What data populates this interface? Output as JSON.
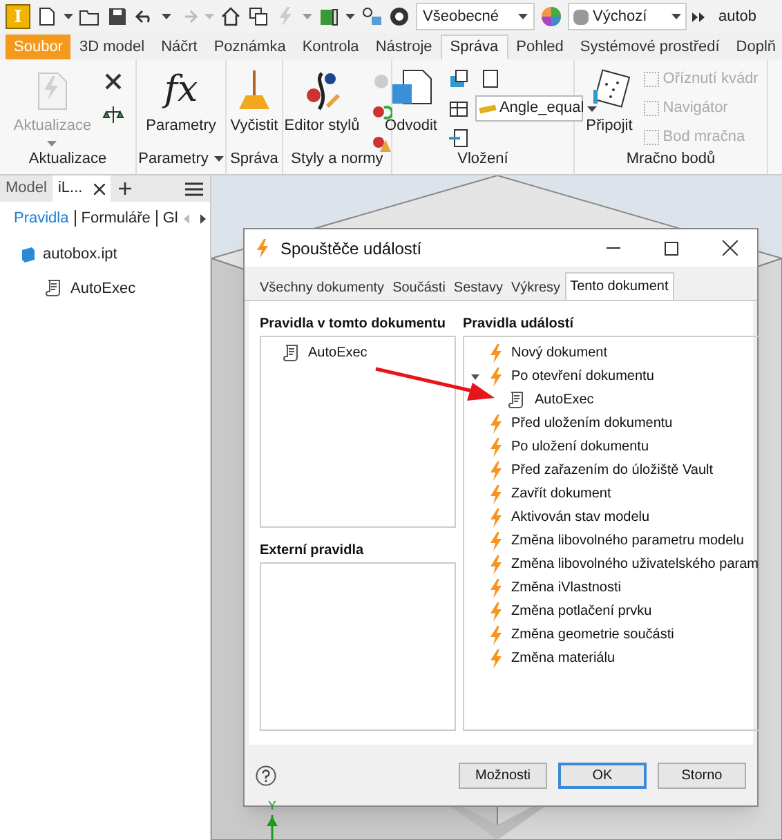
{
  "app_logo": "I",
  "quick_access": {
    "style_dropdown": "Všeobecné",
    "appearance_dropdown": "Výchozí",
    "window_title": "autob"
  },
  "ribbon_tabs": [
    {
      "label": "Soubor",
      "kind": "file",
      "selected": false
    },
    {
      "label": "3D model",
      "kind": "tab",
      "selected": false
    },
    {
      "label": "Náčrt",
      "kind": "tab",
      "selected": false
    },
    {
      "label": "Poznámka",
      "kind": "tab",
      "selected": false
    },
    {
      "label": "Kontrola",
      "kind": "tab",
      "selected": false
    },
    {
      "label": "Nástroje",
      "kind": "tab",
      "selected": false
    },
    {
      "label": "Správa",
      "kind": "tab",
      "selected": true
    },
    {
      "label": "Pohled",
      "kind": "tab",
      "selected": false
    },
    {
      "label": "Systémové prostředí",
      "kind": "tab",
      "selected": false
    },
    {
      "label": "Doplň",
      "kind": "tab",
      "selected": false
    }
  ],
  "ribbon_panels": [
    {
      "title": "Aktualizace",
      "menu": false,
      "tool": {
        "label": "Aktualizace",
        "disabled": true,
        "menu": true
      }
    },
    {
      "title": "Parametry",
      "menu": true,
      "tool": {
        "label": "Parametry",
        "disabled": false,
        "menu": false
      }
    },
    {
      "title": "Správa",
      "menu": false,
      "tool": {
        "label": "Vyčistit",
        "disabled": false,
        "menu": false
      }
    },
    {
      "title": "Styly a normy",
      "menu": false,
      "tool": {
        "label": "Editor stylů",
        "disabled": false,
        "menu": false
      }
    },
    {
      "title": "Vložení",
      "menu": false,
      "tool": {
        "label": "Odvodit",
        "disabled": false,
        "menu": false
      },
      "dropdown": "Angle_equal"
    },
    {
      "title": "Mračno bodů",
      "menu": false,
      "tool": {
        "label": "Připojit",
        "disabled": false,
        "menu": false
      },
      "items": [
        {
          "label": "Oříznutí kvádr",
          "disabled": true
        },
        {
          "label": "Navigátor",
          "disabled": true
        },
        {
          "label": "Bod mračna",
          "disabled": true
        }
      ]
    }
  ],
  "left_panel": {
    "tabs": [
      {
        "label": "Model",
        "selected": false
      },
      {
        "label": "iL...",
        "selected": true
      }
    ],
    "subtabs": [
      {
        "label": "Pravidla",
        "selected": true
      },
      {
        "label": "Formuláře",
        "selected": false
      },
      {
        "label": "Gl",
        "selected": false
      }
    ],
    "tree": [
      {
        "label": "autobox.ipt",
        "kind": "part",
        "children": [
          {
            "label": "AutoExec",
            "kind": "rule"
          }
        ]
      }
    ]
  },
  "dialog": {
    "title": "Spouštěče událostí",
    "tabs": [
      {
        "label": "Všechny dokumenty",
        "selected": false
      },
      {
        "label": "Součásti",
        "selected": false
      },
      {
        "label": "Sestavy",
        "selected": false
      },
      {
        "label": "Výkresy",
        "selected": false
      },
      {
        "label": "Tento dokument",
        "selected": true
      }
    ],
    "document_rules": {
      "heading": "Pravidla v tomto dokumentu",
      "items": [
        "AutoExec"
      ]
    },
    "external_rules": {
      "heading": "Externí pravidla"
    },
    "event_rules": {
      "heading": "Pravidla událostí",
      "items": [
        {
          "label": "Nový dokument"
        },
        {
          "label": "Po otevření dokumentu",
          "expanded": true,
          "children": [
            "AutoExec"
          ]
        },
        {
          "label": "Před uložením dokumentu"
        },
        {
          "label": "Po uložení dokumentu"
        },
        {
          "label": "Před zařazením do úložiště Vault"
        },
        {
          "label": "Zavřít dokument"
        },
        {
          "label": "Aktivován stav modelu"
        },
        {
          "label": "Změna libovolného parametru modelu"
        },
        {
          "label": "Změna libovolného uživatelského param"
        },
        {
          "label": "Změna iVlastnosti"
        },
        {
          "label": "Změna potlačení prvku"
        },
        {
          "label": "Změna geometrie součásti"
        },
        {
          "label": "Změna materiálu"
        }
      ]
    },
    "buttons": [
      {
        "label": "Možnosti",
        "default": false
      },
      {
        "label": "OK",
        "default": true
      },
      {
        "label": "Storno",
        "default": false
      }
    ]
  },
  "axis_label": "Y",
  "function_symbol": "fx"
}
